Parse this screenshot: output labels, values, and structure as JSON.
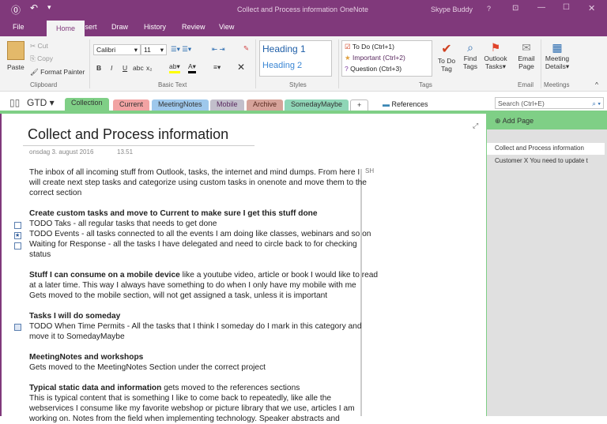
{
  "titlebar": {
    "title": "Collect and Process information",
    "app": "OneNote",
    "user": "Skype Buddy",
    "help": "?"
  },
  "ribbon_tabs": [
    "File",
    "Home",
    "Insert",
    "Draw",
    "History",
    "Review",
    "View"
  ],
  "clipboard": {
    "paste": "Paste",
    "cut": "Cut",
    "copy": "Copy",
    "format_painter": "Format Painter",
    "group": "Clipboard"
  },
  "basic_text": {
    "font": "Calibri",
    "size": "11",
    "bold": "B",
    "italic": "I",
    "underline": "U",
    "strike": "abc",
    "sub": "x₂",
    "group": "Basic Text"
  },
  "styles": {
    "h1": "Heading 1",
    "h2": "Heading 2",
    "group": "Styles"
  },
  "tags": {
    "items": [
      "To Do (Ctrl+1)",
      "Important (Ctrl+2)",
      "Question (Ctrl+3)"
    ],
    "group": "Tags",
    "todo_tag": "To Do Tag",
    "find_tags": "Find Tags",
    "outlook_tasks": "Outlook Tasks"
  },
  "email": {
    "label": "Email Page",
    "group": "Email"
  },
  "meetings": {
    "label": "Meeting Details",
    "group": "Meetings"
  },
  "notebook": {
    "name": "GTD"
  },
  "sections": [
    {
      "label": "Collection",
      "color": "#7fcf86"
    },
    {
      "label": "Current",
      "color": "#f2a3a3"
    },
    {
      "label": "MeetingNotes",
      "color": "#9ec8ec"
    },
    {
      "label": "Mobile",
      "color": "#c2bfcb"
    },
    {
      "label": "Archive",
      "color": "#d6a39a"
    },
    {
      "label": "SomedayMaybe",
      "color": "#8fd6b7"
    }
  ],
  "add_section": "+",
  "references": "References",
  "search": {
    "placeholder": "Search (Ctrl+E)"
  },
  "page": {
    "title": "Collect and Process information",
    "date": "onsdag 3. august 2016",
    "time": "13.51",
    "side_note": "SH",
    "lines": [
      "The inbox of all incoming stuff from Outlook, tasks, the internet and mind dumps. From here I",
      "will create next step tasks and categorize using custom tasks in onenote and move them to the",
      "correct section",
      "Create custom tasks and move to Current to make sure I get this stuff done",
      "TODO Taks - all regular tasks that needs to get done",
      "TODO Events - all tasks connected to all the events I am doing like classes, webinars and so on",
      "Waiting for Response - all the tasks I have delegated and need to circle back to for checking",
      "status",
      "Stuff I can consume on a mobile device",
      " like a youtube video, article or book I would like to read",
      "at a later time. This way I always have something to do when I only have my mobile with me",
      "Gets moved to the mobile section, will not get assigned a task, unless it is important",
      "Tasks I will do someday",
      "TODO When Time Permits - All the tasks that I think I someday do I mark in this category and",
      "move it to SomedayMaybe",
      "MeetingNotes and workshops",
      "Gets moved to the MeetingNotes Section under the correct project",
      "Typical static data and information",
      " gets moved to the references sections",
      "This is typical content that is something I like to come back to repeatedly, like alle the",
      "webservices I consume like my favorite webshop or picture library that we use, articles I am",
      "working on. Notes from the field when implementing technology. Speaker abstracts and"
    ]
  },
  "page_list": {
    "add_page": "Add Page",
    "pages": [
      "Collect and Process information",
      "Customer X You need to update t"
    ]
  }
}
